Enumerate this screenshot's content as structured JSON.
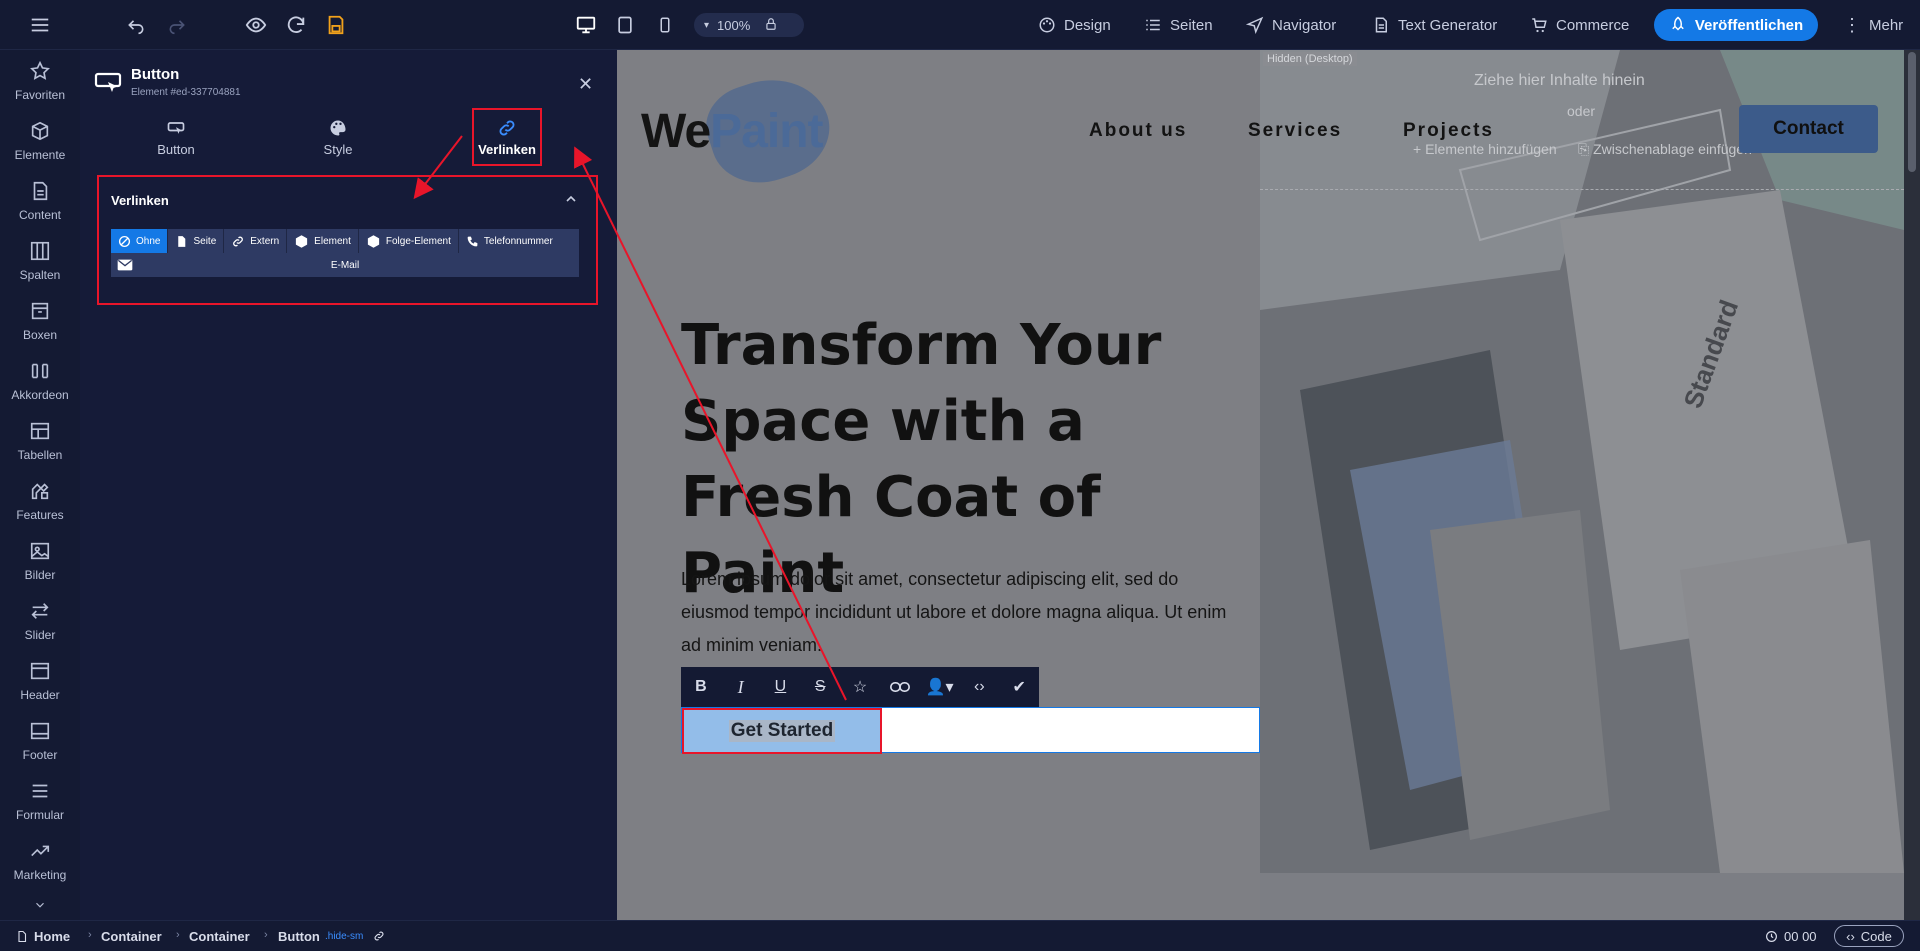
{
  "topbar": {
    "zoom": "100%",
    "menu": {
      "design": "Design",
      "pages": "Seiten",
      "navigator": "Navigator",
      "text_generator": "Text Generator",
      "commerce": "Commerce",
      "more": "Mehr"
    },
    "publish_label": "Veröffentlichen",
    "accent_color": "#1479e6",
    "save_color": "#f2a21b"
  },
  "sidebar": {
    "items": [
      {
        "label": "Favoriten",
        "icon": "star-icon"
      },
      {
        "label": "Elemente",
        "icon": "cube-icon"
      },
      {
        "label": "Content",
        "icon": "document-icon"
      },
      {
        "label": "Spalten",
        "icon": "columns-icon"
      },
      {
        "label": "Boxen",
        "icon": "box-icon"
      },
      {
        "label": "Akkordeon",
        "icon": "accordion-icon"
      },
      {
        "label": "Tabellen",
        "icon": "table-icon"
      },
      {
        "label": "Features",
        "icon": "features-icon"
      },
      {
        "label": "Bilder",
        "icon": "image-icon"
      },
      {
        "label": "Slider",
        "icon": "slider-icon"
      },
      {
        "label": "Header",
        "icon": "header-icon"
      },
      {
        "label": "Footer",
        "icon": "footer-icon"
      },
      {
        "label": "Formular",
        "icon": "form-icon"
      },
      {
        "label": "Marketing",
        "icon": "marketing-icon"
      }
    ]
  },
  "panel": {
    "title": "Button",
    "subtitle": "Element #ed-337704881",
    "tabs": [
      {
        "label": "Button",
        "icon": "button-icon"
      },
      {
        "label": "Style",
        "icon": "palette-icon"
      },
      {
        "label": "Verlinken",
        "icon": "link-icon"
      }
    ],
    "link_section": {
      "header": "Verlinken",
      "options": [
        {
          "label": "Ohne",
          "icon": "none-icon",
          "active": true
        },
        {
          "label": "Seite",
          "icon": "page-icon"
        },
        {
          "label": "Extern",
          "icon": "external-link-icon"
        },
        {
          "label": "Element",
          "icon": "element-cube-icon"
        },
        {
          "label": "Folge-Element",
          "icon": "following-element-icon"
        },
        {
          "label": "Telefonnummer",
          "icon": "phone-icon"
        }
      ],
      "email_label": "E-Mail"
    }
  },
  "canvas": {
    "logo_we": "We",
    "logo_paint": "Paint",
    "nav": [
      "About us",
      "Services",
      "Projects"
    ],
    "contact_label": "Contact",
    "hero_title": "Transform Your Space with a Fresh Coat of Paint",
    "hero_text": "Lorem ipsum dolor sit amet, consectetur adipiscing elit, sed do eiusmod tempor incididunt ut labore et dolore magna aliqua. Ut enim ad minim veniam.",
    "button_label": "Get Started",
    "hidden_label": "Hidden (Desktop)",
    "drop_hint": "Ziehe hier Inhalte hinein",
    "drop_or": "oder",
    "drop_add": "Elemente hinzufügen",
    "drop_paste": "Zwischenablage einfügen"
  },
  "bottombar": {
    "crumbs": [
      "Home",
      "Container",
      "Container",
      "Button"
    ],
    "crumb_class": ".hide-sm",
    "time": "00 00",
    "code_label": "Code"
  }
}
